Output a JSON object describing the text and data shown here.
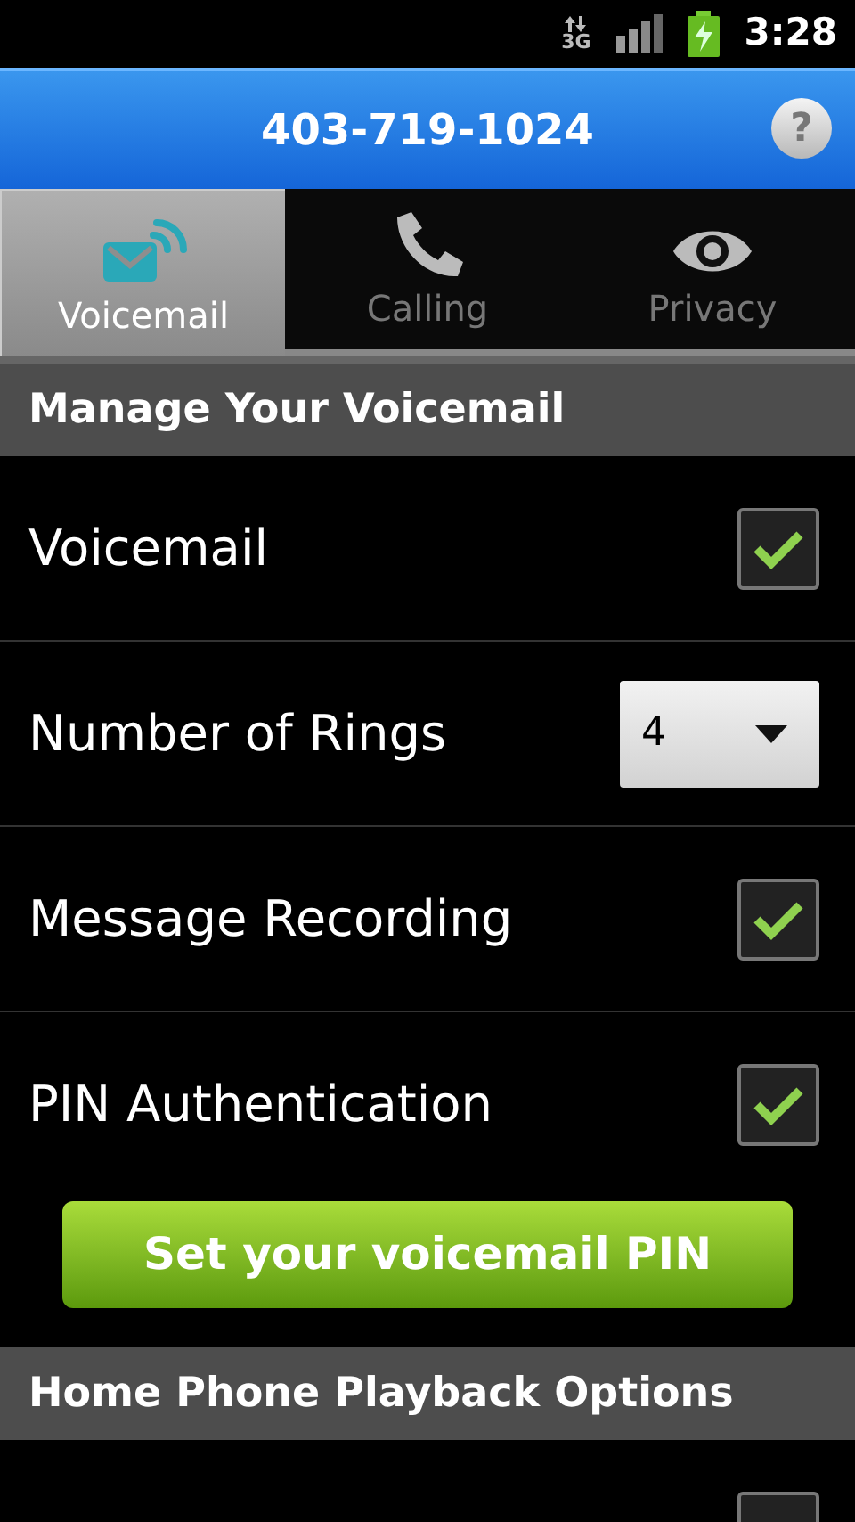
{
  "status_bar": {
    "network": "3G",
    "time": "3:28"
  },
  "header": {
    "title": "403-719-1024",
    "help": "?"
  },
  "tabs": [
    {
      "label": "Voicemail",
      "selected": true
    },
    {
      "label": "Calling",
      "selected": false
    },
    {
      "label": "Privacy",
      "selected": false
    }
  ],
  "sections": [
    {
      "title": "Manage Your Voicemail",
      "items": [
        {
          "kind": "checkbox",
          "label": "Voicemail",
          "checked": true
        },
        {
          "kind": "dropdown",
          "label": "Number of Rings",
          "value": "4"
        },
        {
          "kind": "checkbox",
          "label": "Message Recording",
          "checked": true
        },
        {
          "kind": "checkbox",
          "label": "PIN Authentication",
          "checked": true
        },
        {
          "kind": "button",
          "label": "Set your voicemail PIN"
        }
      ]
    },
    {
      "title": "Home Phone Playback Options",
      "items": [
        {
          "kind": "checkbox",
          "checked": false
        }
      ]
    }
  ]
}
